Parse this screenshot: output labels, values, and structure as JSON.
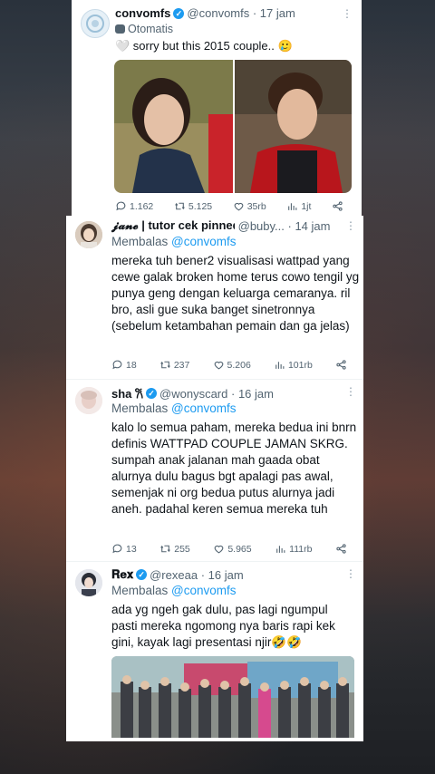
{
  "tweet1": {
    "name": "convomfs",
    "handle": "@convomfs",
    "dot_time": "· 17 jam",
    "automated_label": "Otomatis",
    "text": "🤍 sorry but this 2015 couple.. 🥲",
    "replies": "1.162",
    "retweets": "5.125",
    "likes": "35rb",
    "views": "1jt"
  },
  "tweet2": {
    "name": "𝓳𝓪𝓷𝓮 | tutor cek pinned",
    "handle": "@buby...",
    "dot_time": "· 14 jam",
    "replying_prefix": "Membalas",
    "replying_to": "@convomfs",
    "text": "mereka tuh bener2 visualisasi wattpad yang cewe galak broken home terus cowo tengil yg punya geng dengan keluarga cemaranya. ril bro, asli gue suka banget sinetronnya (sebelum ketambahan pemain dan ga jelas)",
    "replies": "18",
    "retweets": "237",
    "likes": "5.206",
    "views": "101rb"
  },
  "tweet3": {
    "name": "sha 𐙚",
    "handle": "@wonyscard",
    "dot_time": "· 16 jam",
    "replying_prefix": "Membalas",
    "replying_to": "@convomfs",
    "text": "kalo lo semua paham, mereka bedua ini bnrn definis WATTPAD COUPLE JAMAN SKRG. sumpah anak jalanan mah gaada obat alurnya dulu bagus bgt apalagi pas awal, semenjak ni org bedua putus alurnya jadi aneh. padahal keren semua mereka tuh",
    "replies": "13",
    "retweets": "255",
    "likes": "5.965",
    "views": "111rb"
  },
  "tweet4": {
    "name": "𝐑𝐞𝐱",
    "handle": "@rexeaa",
    "dot_time": "· 16 jam",
    "replying_prefix": "Membalas",
    "replying_to": "@convomfs",
    "text": "ada yg ngeh gak dulu, pas lagi ngumpul pasti mereka ngomong nya baris rapi kek gini, kayak lagi presentasi njir🤣🤣"
  },
  "colors": {
    "accent": "#1d9bf0",
    "text": "#0f1419",
    "muted": "#536471"
  },
  "icons": [
    "reply-icon",
    "retweet-icon",
    "like-icon",
    "views-icon",
    "share-icon",
    "verified-icon",
    "more-icon",
    "bot-icon"
  ]
}
